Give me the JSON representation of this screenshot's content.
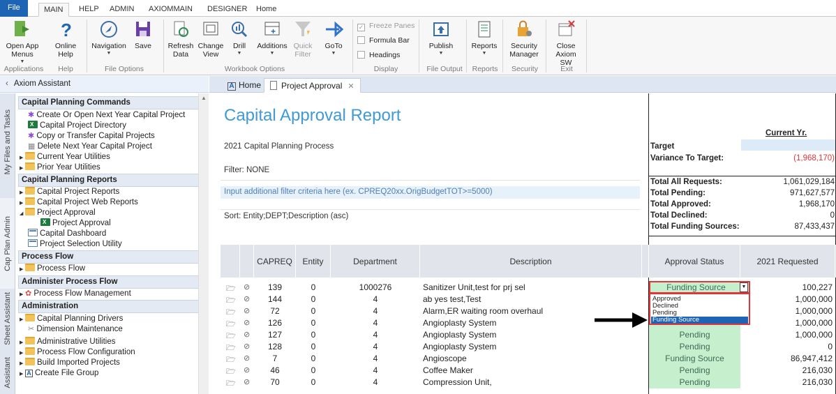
{
  "ribbon_tabs": [
    "File",
    "MAIN",
    "HELP",
    "ADMIN",
    "AXIOMMAIN",
    "DESIGNER",
    "Home"
  ],
  "ribbon": {
    "open_app_menus": "Open App Menus",
    "online_help": "Online Help",
    "navigation": "Navigation",
    "save": "Save",
    "refresh_data": "Refresh Data",
    "change_view": "Change View",
    "drill": "Drill",
    "additions": "Additions",
    "quick_filter": "Quick Filter",
    "goto": "GoTo",
    "freeze_panes": "Freeze Panes",
    "formula_bar": "Formula Bar",
    "headings": "Headings",
    "publish": "Publish",
    "reports": "Reports",
    "security_manager": "Security Manager",
    "close_axiom": "Close Axiom SW",
    "groups": {
      "applications": "Applications",
      "help": "Help",
      "file_options": "File Options",
      "workbook_options": "Workbook Options",
      "display": "Display",
      "file_output": "File Output",
      "reports": "Reports",
      "security": "Security",
      "exit": "Exit"
    }
  },
  "left_panel": {
    "title": "Axiom Assistant",
    "vertical_tabs": [
      "My Files and Tasks",
      "Cap Plan Admin",
      "Sheet Assistant",
      "Assistant"
    ],
    "sections": {
      "capital_planning_commands": "Capital Planning Commands",
      "capital_planning_reports": "Capital Planning Reports",
      "process_flow": "Process Flow",
      "administer_process_flow": "Administer Process Flow",
      "administration": "Administration"
    },
    "items": {
      "create_next_year": "Create Or Open Next Year Capital Project",
      "project_directory": "Capital Project Directory",
      "copy_transfer": "Copy or Transfer Capital Projects",
      "delete_next_year": "Delete Next Year Capital Project",
      "current_year_utilities": "Current Year Utilities",
      "prior_year_utilities": "Prior Year Utilities",
      "project_reports": "Capital Project Reports",
      "project_web_reports": "Capital Project Web Reports",
      "project_approval_folder": "Project Approval",
      "project_approval_file": "Project Approval",
      "capital_dashboard": "Capital Dashboard",
      "project_selection_utility": "Project Selection Utility",
      "process_flow_folder": "Process Flow",
      "process_flow_management": "Process Flow Management",
      "capital_planning_drivers": "Capital Planning Drivers",
      "dimension_maintenance": "Dimension Maintenance",
      "administrative_utilities": "Administrative Utilities",
      "process_flow_configuration": "Process Flow Configuration",
      "build_imported_projects": "Build Imported Projects",
      "create_file_group": "Create File Group"
    }
  },
  "doc_tabs": {
    "home": "Home",
    "project_approval": "Project Approval"
  },
  "report": {
    "title": "Capital Approval Report",
    "subtitle": "2021 Capital Planning Process",
    "filter": "Filter: NONE",
    "filter_input_hint": "Input additional filter criteria here (ex. CPREQ20xx.OrigBudgetTOT>=5000)",
    "sort": "Sort: Entity;DEPT;Description (asc)"
  },
  "summary": {
    "current_year_header": "Current Yr.",
    "target_label": "Target",
    "variance_label": "Variance To Target:",
    "variance_value": "(1,968,170)",
    "total_all_label": "Total All Requests:",
    "total_all_value": "1,061,029,184",
    "total_pending_label": "Total Pending:",
    "total_pending_value": "971,627,577",
    "total_approved_label": "Total Approved:",
    "total_approved_value": "1,968,170",
    "total_declined_label": "Total Declined:",
    "total_declined_value": "0",
    "total_funding_label": "Total Funding Sources:",
    "total_funding_value": "87,433,437"
  },
  "grid": {
    "headers": {
      "capreq": "CAPREQ",
      "entity": "Entity",
      "department": "Department",
      "description": "Description",
      "approval_status": "Approval Status",
      "requested": "2021 Requested"
    },
    "rows": [
      {
        "capreq": "139",
        "entity": "0",
        "dept": "1000276",
        "desc": "Sanitizer Unit,test for prj sel",
        "status": "Funding Source",
        "amount": "100,227"
      },
      {
        "capreq": "144",
        "entity": "0",
        "dept": "4",
        "desc": "ab yes test,Test",
        "status": "",
        "amount": "1,000,000"
      },
      {
        "capreq": "72",
        "entity": "0",
        "dept": "4",
        "desc": "Alarm,ER waiting room overhaul",
        "status": "",
        "amount": "1,000,000"
      },
      {
        "capreq": "126",
        "entity": "0",
        "dept": "4",
        "desc": "Angioplasty System",
        "status": "",
        "amount": "1,000,000"
      },
      {
        "capreq": "127",
        "entity": "0",
        "dept": "4",
        "desc": "Angioplasty System",
        "status": "Pending",
        "amount": "1,000,000"
      },
      {
        "capreq": "128",
        "entity": "0",
        "dept": "4",
        "desc": "Angioplasty System",
        "status": "Pending",
        "amount": "0"
      },
      {
        "capreq": "7",
        "entity": "0",
        "dept": "4",
        "desc": "Angioscope",
        "status": "Funding Source",
        "amount": "86,947,412"
      },
      {
        "capreq": "46",
        "entity": "0",
        "dept": "4",
        "desc": "Coffee Maker",
        "status": "Pending",
        "amount": "216,030"
      },
      {
        "capreq": "70",
        "entity": "0",
        "dept": "4",
        "desc": "Compression Unit,",
        "status": "Pending",
        "amount": "216,030"
      }
    ]
  },
  "dropdown": {
    "options": [
      "Approved",
      "Declined",
      "Pending",
      "Funding Source"
    ],
    "selected": "Funding Source"
  },
  "colors": {
    "file_tab": "#1e64b4",
    "title_blue": "#3f9ad6",
    "status_green": "#c6efce",
    "negative_red": "#e0353a"
  }
}
